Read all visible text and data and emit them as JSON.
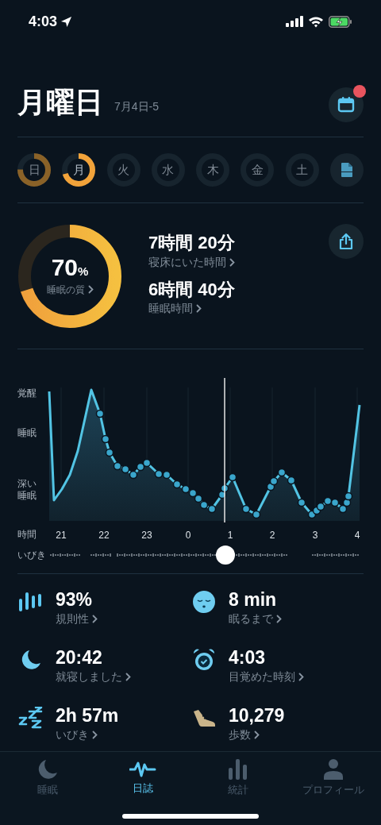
{
  "status_bar": {
    "time": "4:03"
  },
  "header": {
    "title": "月曜日",
    "date": "7月4日-5",
    "calendar_badge": true
  },
  "days": [
    {
      "label": "日",
      "level": 0.75,
      "selected": false
    },
    {
      "label": "月",
      "level": 0.7,
      "selected": true
    },
    {
      "label": "火",
      "level": 0,
      "selected": false
    },
    {
      "label": "水",
      "level": 0,
      "selected": false
    },
    {
      "label": "木",
      "level": 0,
      "selected": false
    },
    {
      "label": "金",
      "level": 0,
      "selected": false
    },
    {
      "label": "土",
      "level": 0,
      "selected": false
    }
  ],
  "summary": {
    "score": "70",
    "score_unit": "%",
    "score_label": "睡眠の質",
    "level": 0.7,
    "metrics": [
      {
        "value": "7時間 20分",
        "label": "寝床にいた時間"
      },
      {
        "value": "6時間 40分",
        "label": "睡眠時間"
      }
    ]
  },
  "sleep_chart": {
    "y_labels": [
      "覚醒",
      "睡眠",
      "深い睡眠"
    ],
    "x_title": "時間",
    "x_labels": [
      "21",
      "22",
      "23",
      "0",
      "1",
      "2",
      "3",
      "4"
    ],
    "snore_label": "いびき"
  },
  "stats": [
    {
      "kind": "regularity",
      "value": "93%",
      "label": "規則性"
    },
    {
      "kind": "fall_asleep",
      "value": "8 min",
      "label": "眠るまで"
    },
    {
      "kind": "bedtime",
      "value": "20:42",
      "label": "就寝しました"
    },
    {
      "kind": "wake",
      "value": "4:03",
      "label": "目覚めた時刻"
    },
    {
      "kind": "snore",
      "value": "2h 57m",
      "label": "いびき"
    },
    {
      "kind": "steps",
      "value": "10,279",
      "label": "歩数"
    }
  ],
  "tabs": [
    {
      "kind": "sleep",
      "label": "睡眠",
      "selected": false
    },
    {
      "kind": "journal",
      "label": "日誌",
      "selected": true
    },
    {
      "kind": "stats",
      "label": "統計",
      "selected": false
    },
    {
      "kind": "profile",
      "label": "プロフィール",
      "selected": false
    }
  ]
}
